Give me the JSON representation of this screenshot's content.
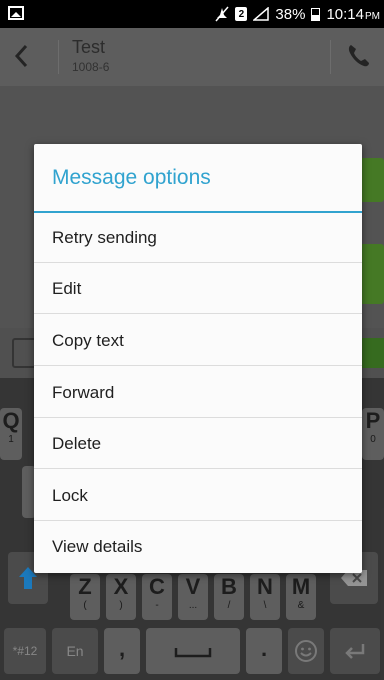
{
  "status_bar": {
    "battery": "38%",
    "time": "10:14",
    "ampm": "PM",
    "sim_badge": "2",
    "icons": [
      "image-icon",
      "mute-icon",
      "sim-icon",
      "signal-icon",
      "battery-icon"
    ]
  },
  "header": {
    "contact_name": "Test",
    "contact_number": "1008-6",
    "icons": [
      "back-icon",
      "phone-icon"
    ]
  },
  "keyboard": {
    "row1_left": "Q",
    "row1_left_sub": "1",
    "row1_right": "P",
    "row1_right_sub": "0",
    "letters": [
      "Z",
      "X",
      "C",
      "V",
      "B",
      "N",
      "M"
    ],
    "letters_sub": [
      "(",
      ")",
      "-",
      "...",
      "/",
      "\\",
      "&"
    ],
    "symbols": "*#12",
    "lang": "En",
    "comma": ",",
    "period": "."
  },
  "dialog": {
    "title": "Message options",
    "options": [
      "Retry sending",
      "Edit",
      "Copy text",
      "Forward",
      "Delete",
      "Lock",
      "View details"
    ]
  },
  "colors": {
    "accent": "#31a3cf",
    "bubble": "#4f8a2b"
  }
}
